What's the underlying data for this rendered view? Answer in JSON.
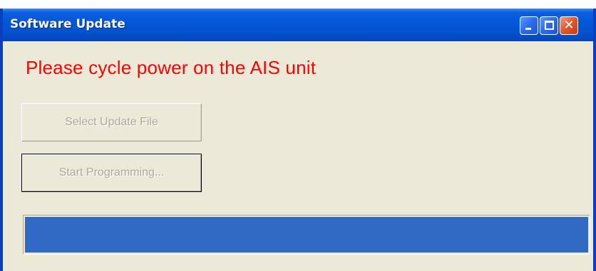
{
  "window": {
    "title": "Software Update",
    "controls": {
      "minimize_icon": "minimize-icon",
      "maximize_icon": "maximize-icon",
      "close_icon": "close-icon",
      "close_glyph": "✕"
    }
  },
  "main": {
    "status_message": "Please cycle power on the AIS unit",
    "status_color": "#ff0000",
    "select_update_file_label": "Select Update File",
    "start_programming_label": "Start Programming...",
    "progress_fraction": 1.0,
    "progress_color": "#316ac5"
  },
  "colors": {
    "titlebar_blue": "#0458d8",
    "window_face": "#ece9d8",
    "disabled_text": "#aca899"
  }
}
